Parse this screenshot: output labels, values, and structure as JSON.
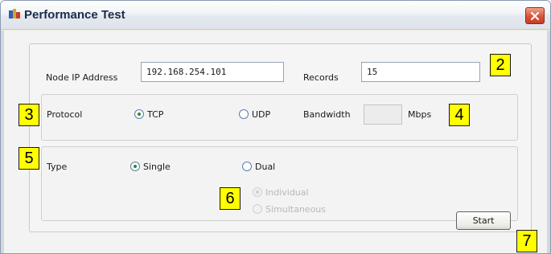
{
  "window": {
    "title": "Performance Test",
    "close_glyph": "✕"
  },
  "form": {
    "node_ip_label": "Node IP Address",
    "node_ip_value": "192.168.254.101",
    "records_label": "Records",
    "records_value": "15",
    "protocol_label": "Protocol",
    "tcp_label": "TCP",
    "udp_label": "UDP",
    "bandwidth_label": "Bandwidth",
    "bandwidth_value": "",
    "mbps_label": "Mbps",
    "type_label": "Type",
    "single_label": "Single",
    "dual_label": "Dual",
    "individual_label": "Individual",
    "simultaneous_label": "Simultaneous",
    "start_label": "Start"
  },
  "annotations": {
    "a2": "2",
    "a3": "3",
    "a4": "4",
    "a5": "5",
    "a6": "6",
    "a7": "7"
  },
  "state": {
    "protocol_selected": "TCP",
    "type_selected": "Single",
    "dual_mode_selected": "Individual",
    "dual_options_enabled": false,
    "bandwidth_enabled": false
  },
  "colors": {
    "highlight": "#ffff00",
    "close_button": "#d9533a",
    "radio_dot": "#2c8a2c"
  }
}
